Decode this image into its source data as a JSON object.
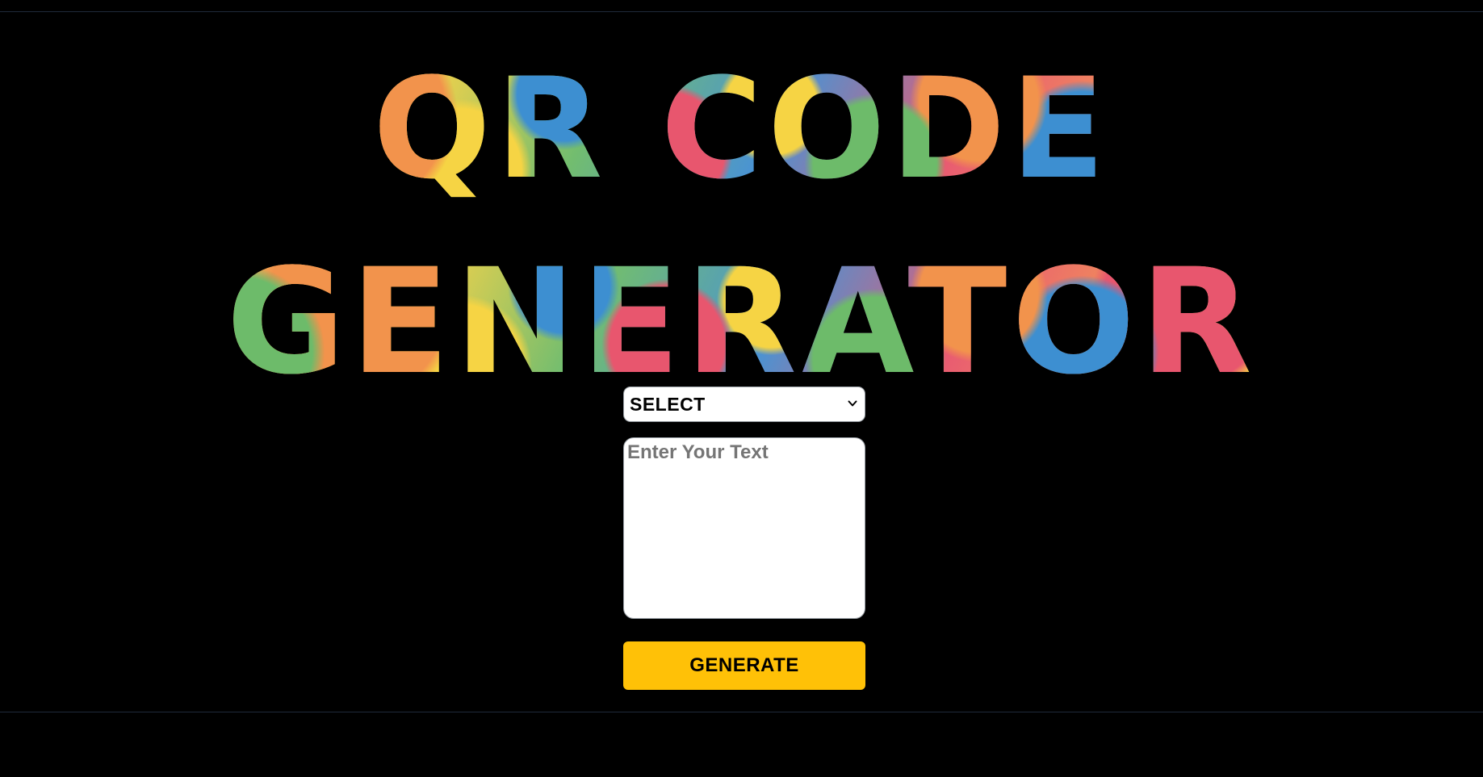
{
  "header": {
    "title_line1": "QR CODE",
    "title_line2": "GENERATOR"
  },
  "form": {
    "type_select": {
      "selected_label": "SELECT",
      "icon": "chevron-down-icon"
    },
    "text_input": {
      "value": "",
      "placeholder": "Enter Your Text"
    },
    "generate_button_label": "GENERATE"
  },
  "colors": {
    "background": "#000000",
    "button_accent": "#ffc107",
    "field_background": "#ffffff",
    "placeholder": "#757575"
  }
}
